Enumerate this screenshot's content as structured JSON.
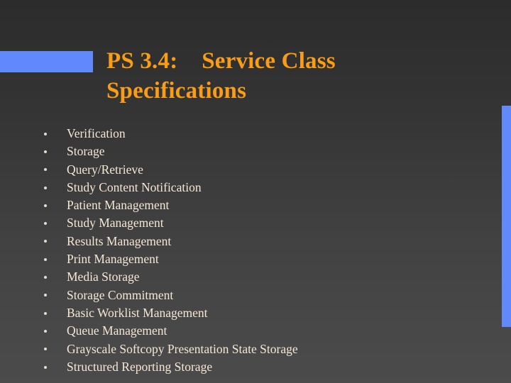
{
  "slide": {
    "title_line_1": "PS 3.4:    Service Class",
    "title_line_2": "Specifications",
    "title_color": "#f99d17",
    "body_text_color": "#f6e7d4",
    "accent_color": "#6189fb",
    "background_top_color": "#2c2c2c",
    "background_bottom_color": "#4b4b4b",
    "bullets": [
      {
        "label": "Verification"
      },
      {
        "label": "Storage"
      },
      {
        "label": "Query/Retrieve"
      },
      {
        "label": "Study Content Notification"
      },
      {
        "label": "Patient Management"
      },
      {
        "label": "Study Management"
      },
      {
        "label": "Results Management"
      },
      {
        "label": "Print Management"
      },
      {
        "label": "Media Storage"
      },
      {
        "label": "Storage Commitment"
      },
      {
        "label": "Basic Worklist Management"
      },
      {
        "label": "Queue Management"
      },
      {
        "label": "Grayscale Softcopy Presentation State Storage"
      },
      {
        "label": "Structured Reporting Storage"
      }
    ]
  }
}
